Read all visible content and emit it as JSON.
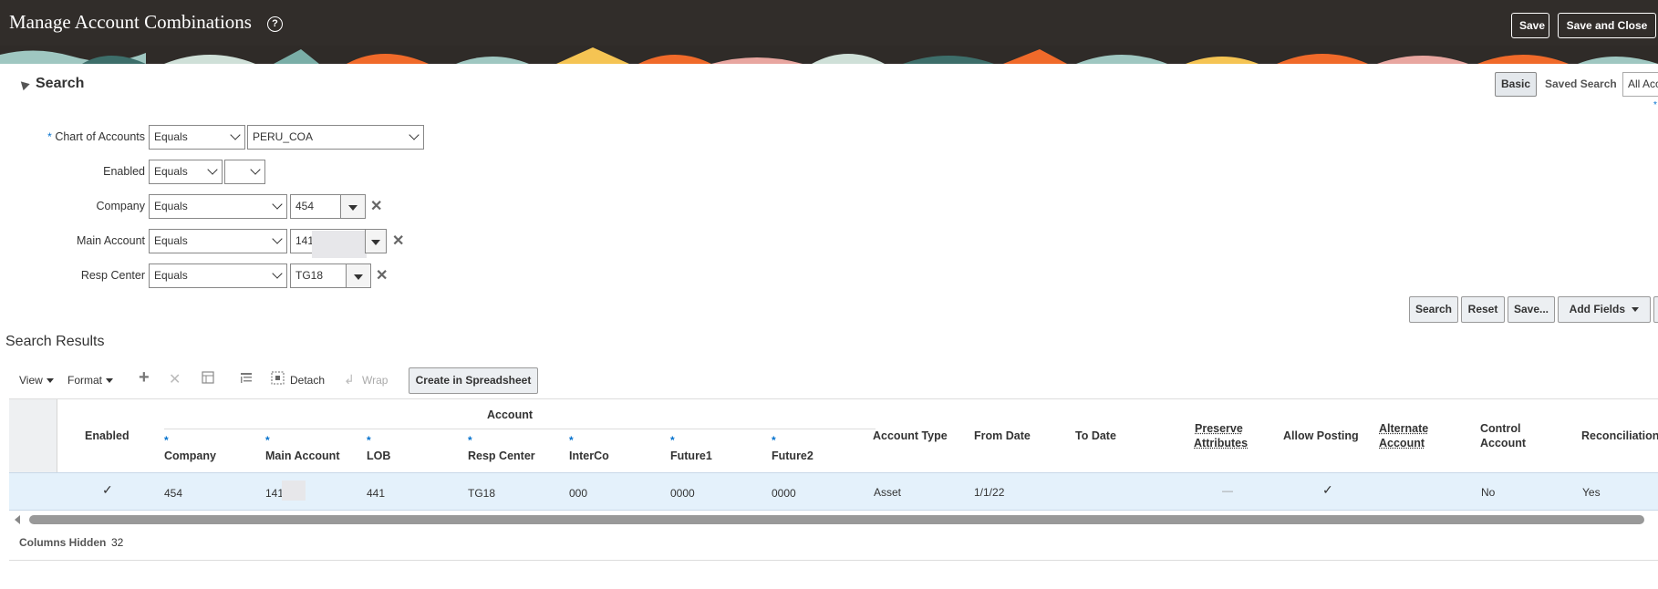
{
  "header": {
    "title": "Manage Account Combinations",
    "help_icon": "?",
    "save_label": "Save",
    "save_close_label": "Save and Close",
    "colors": {
      "bar": "#312d2a",
      "text": "#ffffff"
    }
  },
  "search": {
    "title": "Search",
    "basic_label": "Basic",
    "saved_search_label": "Saved Search",
    "saved_search_value": "All Acc",
    "fields": {
      "chart": {
        "label": "Chart of Accounts",
        "operator": "Equals",
        "value": "PERU_COA"
      },
      "enabled": {
        "label": "Enabled",
        "operator": "Equals",
        "value": ""
      },
      "company": {
        "label": "Company",
        "operator": "Equals",
        "value": "454"
      },
      "main_account": {
        "label": "Main Account",
        "operator": "Equals",
        "value": "141"
      },
      "resp_center": {
        "label": "Resp Center",
        "operator": "Equals",
        "value": "TG18"
      }
    },
    "actions": {
      "search": "Search",
      "reset": "Reset",
      "save": "Save...",
      "add_fields": "Add Fields"
    }
  },
  "results": {
    "title": "Search Results",
    "toolbar": {
      "view": "View",
      "format": "Format",
      "detach": "Detach",
      "wrap": "Wrap",
      "create_spreadsheet": "Create in Spreadsheet"
    },
    "group_header": "Account",
    "columns": {
      "enabled": "Enabled",
      "company": "Company",
      "main_account": "Main Account",
      "lob": "LOB",
      "resp_center": "Resp Center",
      "interco": "InterCo",
      "future1": "Future1",
      "future2": "Future2",
      "account_type": "Account Type",
      "from_date": "From Date",
      "to_date": "To Date",
      "preserve_1": "Preserve",
      "preserve_2": "Attributes",
      "allow_posting": "Allow Posting",
      "alternate_1": "Alternate",
      "alternate_2": "Account",
      "control_1": "Control",
      "control_2": "Account",
      "reconciliation": "Reconciliation"
    },
    "rows": [
      {
        "enabled": "✓",
        "company": "454",
        "main_account": "141",
        "lob": "441",
        "resp_center": "TG18",
        "interco": "000",
        "future1": "0000",
        "future2": "0000",
        "account_type": "Asset",
        "from_date": "1/1/22",
        "to_date": "",
        "preserve_attributes": "—",
        "allow_posting": "✓",
        "alternate_account": "",
        "control_account": "No",
        "reconciliation": "Yes"
      }
    ],
    "columns_hidden_label": "Columns Hidden",
    "columns_hidden_count": "32"
  }
}
